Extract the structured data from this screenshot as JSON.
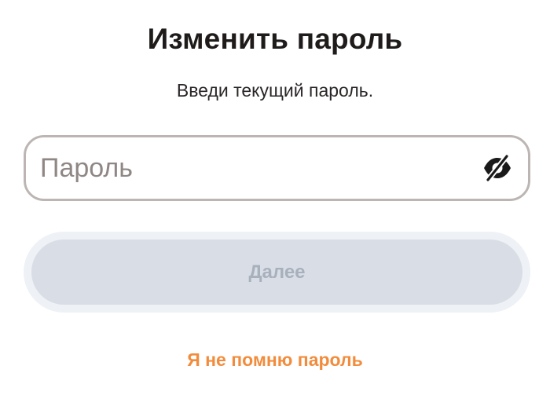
{
  "header": {
    "title": "Изменить пароль",
    "subtitle": "Введи текущий пароль."
  },
  "password_field": {
    "placeholder": "Пароль",
    "value": "",
    "toggle_icon": "eye-off-icon"
  },
  "next_button": {
    "label": "Далее",
    "enabled": false
  },
  "forgot_link": {
    "label": "Я не помню пароль"
  },
  "colors": {
    "title": "#1f1b1b",
    "field_border": "#bcb5b3",
    "placeholder": "#8f8785",
    "button_ring": "#eef1f5",
    "button_bg": "#d9dee6",
    "button_text": "#a8b0bc",
    "link": "#f28c3c"
  }
}
